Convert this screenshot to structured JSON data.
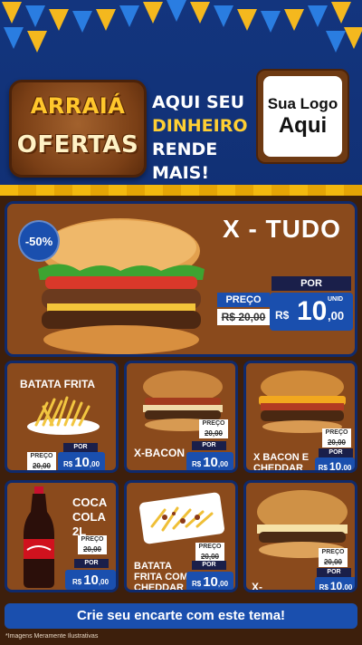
{
  "header": {
    "logo_line1": "ARRAIÁ",
    "logo_line2": "OFERTAS",
    "slogan": [
      "AQUI SEU",
      "DINHEIRO",
      "RENDE MAIS!"
    ],
    "brand_line1": "Sua Logo",
    "brand_line2": "Aqui"
  },
  "hero": {
    "discount": "-50%",
    "title": "X - TUDO",
    "old_label": "PREÇO",
    "old_price": "R$ 20,00",
    "por_label": "POR",
    "currency": "R$",
    "price_int": "10",
    "price_cents": ",00",
    "unit": "UNID"
  },
  "products": [
    {
      "name": "BATATA FRITA",
      "old_label": "PREÇO",
      "old_price": "20,00",
      "por_label": "POR",
      "currency": "R$",
      "price_int": "10",
      "price_cents": ",00",
      "unit": "POÇ"
    },
    {
      "name": "X-BACON",
      "old_label": "PREÇO",
      "old_price": "20,00",
      "por_label": "POR",
      "currency": "R$",
      "price_int": "10",
      "price_cents": ",00",
      "unit": "UNID"
    },
    {
      "name": "X BACON E CHEDDAR",
      "old_label": "PREÇO",
      "old_price": "20,00",
      "por_label": "POR",
      "currency": "R$",
      "price_int": "10",
      "price_cents": ",00",
      "unit": "UNID"
    },
    {
      "name": "COCA COLA 2L",
      "old_label": "PREÇO",
      "old_price": "20,00",
      "por_label": "POR",
      "currency": "R$",
      "price_int": "10",
      "price_cents": ",00",
      "unit": "UNID"
    },
    {
      "name": "BATATA FRITA COM CHEDDAR",
      "old_label": "PREÇO",
      "old_price": "20,00",
      "por_label": "POR",
      "currency": "R$",
      "price_int": "10",
      "price_cents": ",00",
      "unit": "POÇ"
    },
    {
      "name": "X-BURGUER",
      "old_label": "PREÇO",
      "old_price": "20,00",
      "por_label": "POR",
      "currency": "R$",
      "price_int": "10",
      "price_cents": ",00",
      "unit": "UNID"
    }
  ],
  "footer": {
    "cta": "Crie seu encarte com este tema!",
    "disclaimer": "*Imagens Meramente Ilustrativas"
  },
  "colors": {
    "accent_blue": "#1a4fae",
    "card_brown": "#8a4a1c",
    "flag_yellow": "#f4b81e"
  }
}
